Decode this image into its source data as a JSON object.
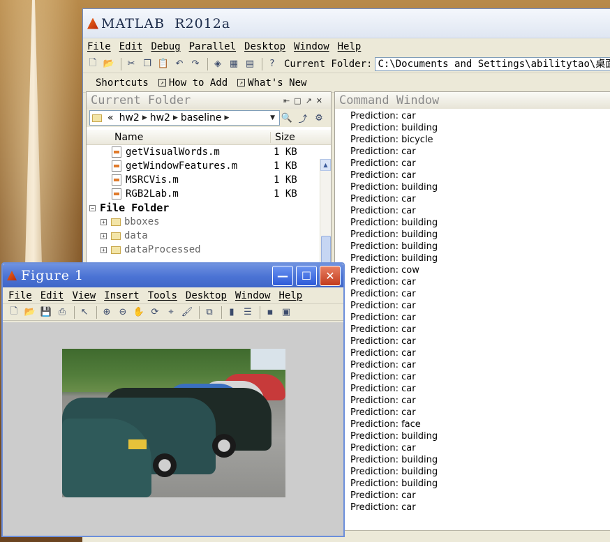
{
  "matlab": {
    "title": "MATLAB  R2012a",
    "menu": [
      "File",
      "Edit",
      "Debug",
      "Parallel",
      "Desktop",
      "Window",
      "Help"
    ],
    "current_folder_label": "Current Folder:",
    "current_folder_path": "C:\\Documents and Settings\\abilitytao\\桌面\\",
    "shortcuts": [
      "Shortcuts",
      "How to Add",
      "What's New"
    ]
  },
  "current_folder": {
    "title": "Current Folder",
    "breadcrumb": [
      "«",
      "hw2",
      "hw2",
      "baseline"
    ],
    "columns": {
      "name": "Name",
      "size": "Size"
    },
    "files": [
      {
        "name": "getVisualWords.m",
        "size": "1 KB"
      },
      {
        "name": "getWindowFeatures.m",
        "size": "1 KB"
      },
      {
        "name": "MSRCVis.m",
        "size": "1 KB"
      },
      {
        "name": "RGB2Lab.m",
        "size": "1 KB"
      }
    ],
    "group_label": "File Folder",
    "folders": [
      "bboxes",
      "data",
      "dataProcessed"
    ]
  },
  "command_window": {
    "title": "Command Window",
    "lines": [
      "Prediction: car",
      "Prediction: building",
      "Prediction: bicycle",
      "Prediction: car",
      "Prediction: car",
      "Prediction: car",
      "Prediction: building",
      "Prediction: car",
      "Prediction: car",
      "Prediction: building",
      "Prediction: building",
      "Prediction: building",
      "Prediction: building",
      "Prediction: cow",
      "Prediction: car",
      "Prediction: car",
      "Prediction: car",
      "Prediction: car",
      "Prediction: car",
      "Prediction: car",
      "Prediction: car",
      "Prediction: car",
      "Prediction: car",
      "Prediction: car",
      "Prediction: car",
      "Prediction: car",
      "Prediction: face",
      "Prediction: building",
      "Prediction: car",
      "Prediction: building",
      "Prediction: building",
      "Prediction: building",
      "Prediction: car",
      "Prediction: car"
    ]
  },
  "figure": {
    "title": "Figure 1",
    "menu": [
      "File",
      "Edit",
      "View",
      "Insert",
      "Tools",
      "Desktop",
      "Window",
      "Help"
    ]
  }
}
